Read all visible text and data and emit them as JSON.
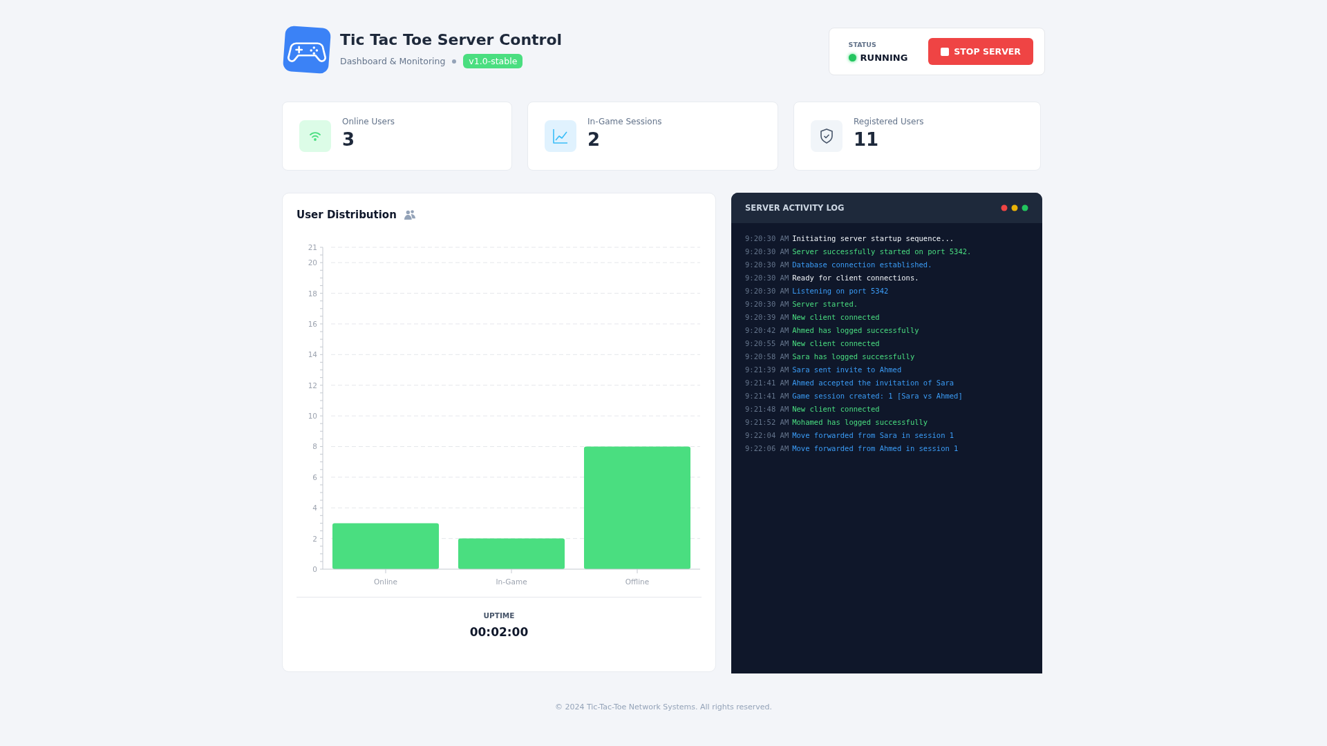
{
  "header": {
    "title": "Tic Tac Toe Server Control",
    "subtitle": "Dashboard & Monitoring",
    "version": "v1.0-stable"
  },
  "status": {
    "label": "STATUS",
    "value": "RUNNING",
    "running": true,
    "button": "STOP SERVER"
  },
  "stats": [
    {
      "kind": "wifi",
      "label": "Online Users",
      "value": "3"
    },
    {
      "kind": "chart",
      "label": "In-Game Sessions",
      "value": "2"
    },
    {
      "kind": "shield",
      "label": "Registered Users",
      "value": "11"
    }
  ],
  "distribution": {
    "title": "User Distribution",
    "chart_data": {
      "type": "bar",
      "categories": [
        "Online",
        "In-Game",
        "Offline"
      ],
      "values": [
        3,
        2,
        8
      ],
      "grid": true,
      "ylim": [
        0,
        21
      ],
      "yticks": [
        0,
        2,
        4,
        6,
        8,
        10,
        12,
        14,
        16,
        18,
        20,
        21
      ]
    },
    "uptime_label": "UPTIME",
    "uptime": "00:02:00"
  },
  "log": {
    "title": "SERVER ACTIVITY LOG",
    "entries": [
      {
        "time": "9:20:30 AM",
        "message": "Initiating server startup sequence...",
        "kind": "plain"
      },
      {
        "time": "9:20:30 AM",
        "message": "Server successfully started on port 5342.",
        "kind": "success"
      },
      {
        "time": "9:20:30 AM",
        "message": "Database connection established.",
        "kind": "info"
      },
      {
        "time": "9:20:30 AM",
        "message": "Ready for client connections.",
        "kind": "plain"
      },
      {
        "time": "9:20:30 AM",
        "message": "Listening on port 5342",
        "kind": "info"
      },
      {
        "time": "9:20:30 AM",
        "message": "Server started.",
        "kind": "success"
      },
      {
        "time": "9:20:39 AM",
        "message": "New client connected",
        "kind": "success"
      },
      {
        "time": "9:20:42 AM",
        "message": "Ahmed has logged successfully",
        "kind": "success"
      },
      {
        "time": "9:20:55 AM",
        "message": "New client connected",
        "kind": "success"
      },
      {
        "time": "9:20:58 AM",
        "message": "Sara has logged successfully",
        "kind": "success"
      },
      {
        "time": "9:21:39 AM",
        "message": "Sara sent invite to Ahmed",
        "kind": "info"
      },
      {
        "time": "9:21:41 AM",
        "message": "Ahmed accepted the invitation of Sara",
        "kind": "info"
      },
      {
        "time": "9:21:41 AM",
        "message": "Game session created: 1 [Sara vs Ahmed]",
        "kind": "info"
      },
      {
        "time": "9:21:48 AM",
        "message": "New client connected",
        "kind": "success"
      },
      {
        "time": "9:21:52 AM",
        "message": "Mohamed has logged successfully",
        "kind": "success"
      },
      {
        "time": "9:22:04 AM",
        "message": "Move forwarded from Sara in session 1",
        "kind": "info"
      },
      {
        "time": "9:22:06 AM",
        "message": "Move forwarded from Ahmed in session 1",
        "kind": "info"
      }
    ]
  },
  "footer": "© 2024 Tic-Tac-Toe Network Systems. All rights reserved."
}
